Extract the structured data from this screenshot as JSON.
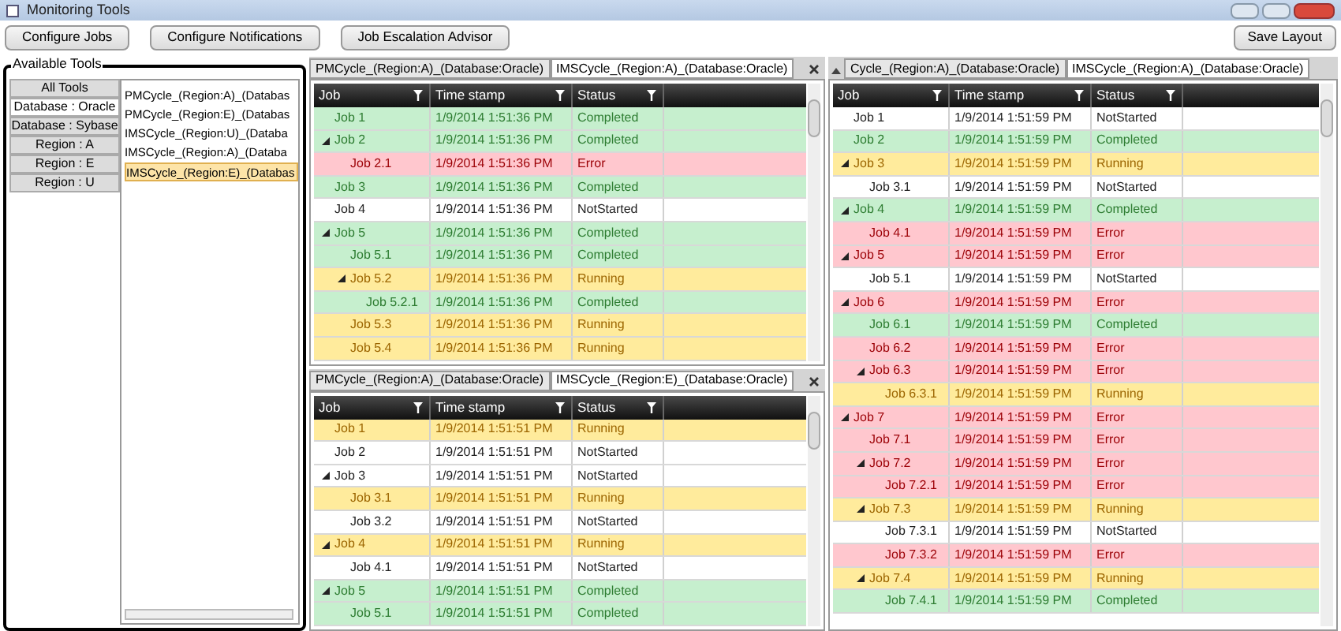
{
  "window": {
    "title": "Monitoring Tools"
  },
  "toolbar": {
    "buttons": [
      "Configure Jobs",
      "Configure Notifications",
      "Job Escalation Advisor"
    ],
    "save_button": "Save Layout"
  },
  "tools_panel": {
    "title": "Available Tools",
    "filters": [
      {
        "label": "All Tools",
        "selected": false
      },
      {
        "label": "Database : Oracle",
        "selected": true
      },
      {
        "label": "Database : Sybase",
        "selected": false
      },
      {
        "label": "Region : A",
        "selected": false
      },
      {
        "label": "Region : E",
        "selected": false
      },
      {
        "label": "Region : U",
        "selected": false
      }
    ],
    "tools": [
      {
        "label": "PMCycle_(Region:A)_(Databas",
        "selected": false
      },
      {
        "label": "PMCycle_(Region:E)_(Databas",
        "selected": false
      },
      {
        "label": "IMSCycle_(Region:U)_(Databa",
        "selected": false
      },
      {
        "label": "IMSCycle_(Region:A)_(Databa",
        "selected": false
      },
      {
        "label": "IMSCycle_(Region:E)_(Databas",
        "selected": true
      }
    ]
  },
  "panels": [
    {
      "closable": true,
      "tabs": [
        {
          "label": "PMCycle_(Region:A)_(Database:Oracle)",
          "selected": false
        },
        {
          "label": "IMSCycle_(Region:A)_(Database:Oracle)",
          "selected": true
        }
      ],
      "columns": [
        "Job",
        "Time stamp",
        "Status"
      ],
      "rows": [
        {
          "job": "Job 1",
          "time": "1/9/2014 1:51:36 PM",
          "status": "Completed",
          "kind": "completed"
        },
        {
          "job": "Job 2",
          "time": "1/9/2014 1:51:36 PM",
          "status": "Completed",
          "kind": "completed",
          "expanded": true,
          "children": [
            {
              "job": "Job 2.1",
              "time": "1/9/2014 1:51:36 PM",
              "status": "Error",
              "kind": "error"
            }
          ]
        },
        {
          "job": "Job 3",
          "time": "1/9/2014 1:51:36 PM",
          "status": "Completed",
          "kind": "completed"
        },
        {
          "job": "Job 4",
          "time": "1/9/2014 1:51:36 PM",
          "status": "NotStarted",
          "kind": "notstarted"
        },
        {
          "job": "Job 5",
          "time": "1/9/2014 1:51:36 PM",
          "status": "Completed",
          "kind": "completed",
          "expanded": true,
          "children": [
            {
              "job": "Job 5.1",
              "time": "1/9/2014 1:51:36 PM",
              "status": "Completed",
              "kind": "completed"
            },
            {
              "job": "Job 5.2",
              "time": "1/9/2014 1:51:36 PM",
              "status": "Running",
              "kind": "running",
              "expanded": true,
              "children": [
                {
                  "job": "Job 5.2.1",
                  "time": "1/9/2014 1:51:36 PM",
                  "status": "Completed",
                  "kind": "completed"
                }
              ]
            },
            {
              "job": "Job 5.3",
              "time": "1/9/2014 1:51:36 PM",
              "status": "Running",
              "kind": "running"
            },
            {
              "job": "Job 5.4",
              "time": "1/9/2014 1:51:36 PM",
              "status": "Running",
              "kind": "running"
            }
          ]
        }
      ]
    },
    {
      "closable": true,
      "tabs": [
        {
          "label": "PMCycle_(Region:A)_(Database:Oracle)",
          "selected": false
        },
        {
          "label": "IMSCycle_(Region:E)_(Database:Oracle)",
          "selected": true
        }
      ],
      "columns": [
        "Job",
        "Time stamp",
        "Status"
      ],
      "rows": [
        {
          "job": "Job 1",
          "time": "1/9/2014 1:51:51 PM",
          "status": "Running",
          "kind": "running"
        },
        {
          "job": "Job 2",
          "time": "1/9/2014 1:51:51 PM",
          "status": "NotStarted",
          "kind": "notstarted"
        },
        {
          "job": "Job 3",
          "time": "1/9/2014 1:51:51 PM",
          "status": "NotStarted",
          "kind": "notstarted",
          "expanded": true,
          "children": [
            {
              "job": "Job 3.1",
              "time": "1/9/2014 1:51:51 PM",
              "status": "Running",
              "kind": "running"
            },
            {
              "job": "Job 3.2",
              "time": "1/9/2014 1:51:51 PM",
              "status": "NotStarted",
              "kind": "notstarted"
            }
          ]
        },
        {
          "job": "Job 4",
          "time": "1/9/2014 1:51:51 PM",
          "status": "Running",
          "kind": "running",
          "expanded": true,
          "children": [
            {
              "job": "Job 4.1",
              "time": "1/9/2014 1:51:51 PM",
              "status": "NotStarted",
              "kind": "notstarted"
            }
          ]
        },
        {
          "job": "Job 5",
          "time": "1/9/2014 1:51:51 PM",
          "status": "Completed",
          "kind": "completed",
          "expanded": true,
          "children": [
            {
              "job": "Job 5.1",
              "time": "1/9/2014 1:51:51 PM",
              "status": "Completed",
              "kind": "completed"
            }
          ]
        }
      ]
    },
    {
      "closable": false,
      "tabs": [
        {
          "label": "Cycle_(Region:A)_(Database:Oracle)",
          "selected": false
        },
        {
          "label": "IMSCycle_(Region:A)_(Database:Oracle)",
          "selected": true
        }
      ],
      "columns": [
        "Job",
        "Time stamp",
        "Status"
      ],
      "rows": [
        {
          "job": "Job 1",
          "time": "1/9/2014 1:51:59 PM",
          "status": "NotStarted",
          "kind": "notstarted"
        },
        {
          "job": "Job 2",
          "time": "1/9/2014 1:51:59 PM",
          "status": "Completed",
          "kind": "completed"
        },
        {
          "job": "Job 3",
          "time": "1/9/2014 1:51:59 PM",
          "status": "Running",
          "kind": "running",
          "expanded": true,
          "children": [
            {
              "job": "Job 3.1",
              "time": "1/9/2014 1:51:59 PM",
              "status": "NotStarted",
              "kind": "notstarted"
            }
          ]
        },
        {
          "job": "Job 4",
          "time": "1/9/2014 1:51:59 PM",
          "status": "Completed",
          "kind": "completed",
          "expanded": true,
          "children": [
            {
              "job": "Job 4.1",
              "time": "1/9/2014 1:51:59 PM",
              "status": "Error",
              "kind": "error"
            }
          ]
        },
        {
          "job": "Job 5",
          "time": "1/9/2014 1:51:59 PM",
          "status": "Error",
          "kind": "error",
          "expanded": true,
          "children": [
            {
              "job": "Job 5.1",
              "time": "1/9/2014 1:51:59 PM",
              "status": "NotStarted",
              "kind": "notstarted"
            }
          ]
        },
        {
          "job": "Job 6",
          "time": "1/9/2014 1:51:59 PM",
          "status": "Error",
          "kind": "error",
          "expanded": true,
          "children": [
            {
              "job": "Job 6.1",
              "time": "1/9/2014 1:51:59 PM",
              "status": "Completed",
              "kind": "completed"
            },
            {
              "job": "Job 6.2",
              "time": "1/9/2014 1:51:59 PM",
              "status": "Error",
              "kind": "error"
            },
            {
              "job": "Job 6.3",
              "time": "1/9/2014 1:51:59 PM",
              "status": "Error",
              "kind": "error",
              "expanded": true,
              "children": [
                {
                  "job": "Job 6.3.1",
                  "time": "1/9/2014 1:51:59 PM",
                  "status": "Running",
                  "kind": "running"
                }
              ]
            }
          ]
        },
        {
          "job": "Job 7",
          "time": "1/9/2014 1:51:59 PM",
          "status": "Error",
          "kind": "error",
          "expanded": true,
          "children": [
            {
              "job": "Job 7.1",
              "time": "1/9/2014 1:51:59 PM",
              "status": "Error",
              "kind": "error"
            },
            {
              "job": "Job 7.2",
              "time": "1/9/2014 1:51:59 PM",
              "status": "Error",
              "kind": "error",
              "expanded": true,
              "children": [
                {
                  "job": "Job 7.2.1",
                  "time": "1/9/2014 1:51:59 PM",
                  "status": "Error",
                  "kind": "error"
                }
              ]
            },
            {
              "job": "Job 7.3",
              "time": "1/9/2014 1:51:59 PM",
              "status": "Running",
              "kind": "running",
              "expanded": true,
              "children": [
                {
                  "job": "Job 7.3.1",
                  "time": "1/9/2014 1:51:59 PM",
                  "status": "NotStarted",
                  "kind": "notstarted"
                },
                {
                  "job": "Job 7.3.2",
                  "time": "1/9/2014 1:51:59 PM",
                  "status": "Error",
                  "kind": "error"
                }
              ]
            },
            {
              "job": "Job 7.4",
              "time": "1/9/2014 1:51:59 PM",
              "status": "Running",
              "kind": "running",
              "expanded": true,
              "children": [
                {
                  "job": "Job 7.4.1",
                  "time": "1/9/2014 1:51:59 PM",
                  "status": "Completed",
                  "kind": "completed"
                }
              ]
            }
          ]
        }
      ]
    }
  ]
}
